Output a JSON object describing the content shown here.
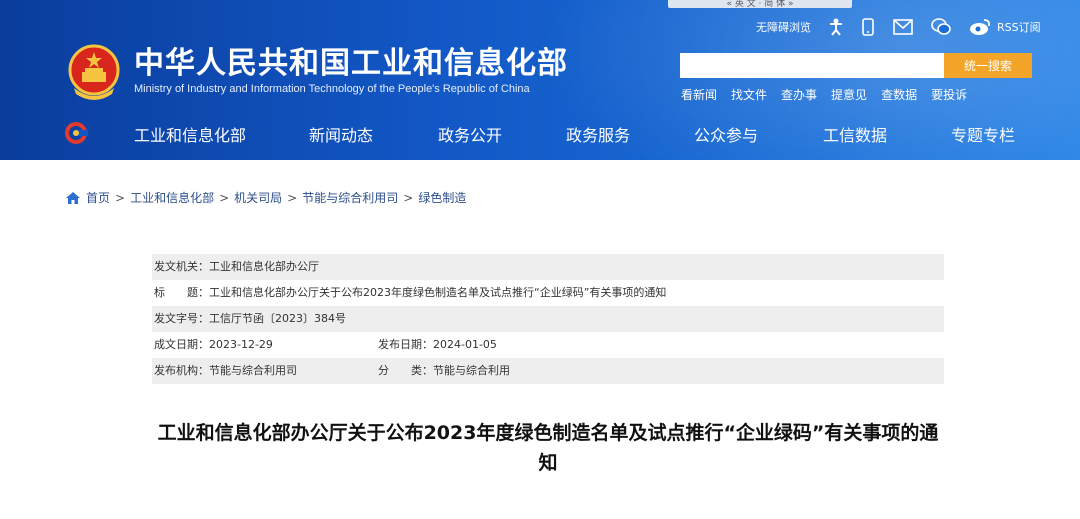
{
  "header": {
    "title": "中华人民共和国工业和信息化部",
    "subtitle": "Ministry of Industry and Information Technology of the People's Republic of China",
    "topbar_fragment": "« 英 文 · 简 体 »",
    "utilities": {
      "accessibility": "无障碍浏览",
      "rss": "RSS订阅"
    },
    "search": {
      "placeholder": "",
      "button": "统一搜索"
    },
    "quick_links": [
      "看新闻",
      "找文件",
      "查办事",
      "提意见",
      "查数据",
      "要投诉"
    ]
  },
  "nav": {
    "items": [
      "工业和信息化部",
      "新闻动态",
      "政务公开",
      "政务服务",
      "公众参与",
      "工信数据",
      "专题专栏"
    ]
  },
  "breadcrumb": [
    "首页",
    "工业和信息化部",
    "机关司局",
    "节能与综合利用司",
    "绿色制造"
  ],
  "meta": {
    "issuer": "发文机关：工业和信息化部办公厅",
    "title": "标　　题：工业和信息化部办公厅关于公布2023年度绿色制造名单及试点推行“企业绿码”有关事项的通知",
    "doc_no": "发文字号：工信厅节函〔2023〕384号",
    "written_date": "成文日期：2023-12-29",
    "publish_date": "发布日期：2024-01-05",
    "publisher": "发布机构：节能与综合利用司",
    "category": "分　　类：节能与综合利用"
  },
  "document": {
    "title": "工业和信息化部办公厅关于公布2023年度绿色制造名单及试点推行“企业绿码”有关事项的通知"
  },
  "colors": {
    "header_blue": "#1257c5",
    "search_button": "#f3a52a",
    "meta_shade": "#eeeeee"
  }
}
